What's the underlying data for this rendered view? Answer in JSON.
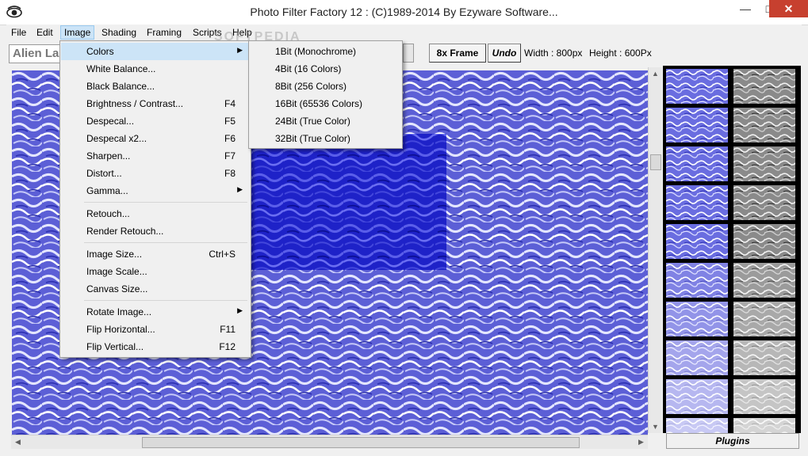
{
  "window": {
    "title": "Photo Filter Factory 12 : (C)1989-2014 By Ezyware Software..."
  },
  "menubar": [
    {
      "label": "File"
    },
    {
      "label": "Edit"
    },
    {
      "label": "Image"
    },
    {
      "label": "Shading"
    },
    {
      "label": "Framing"
    },
    {
      "label": "Scripts"
    },
    {
      "label": "Help"
    }
  ],
  "toolbar": {
    "filter_name": "Alien Landscape",
    "frame_label": "8x Frame",
    "undo_label": "Undo",
    "width_label": "Width : 800px",
    "height_label": "Height : 600Px"
  },
  "image_menu": [
    {
      "label": "Colors",
      "submenu": true
    },
    {
      "label": "White Balance..."
    },
    {
      "label": "Black Balance..."
    },
    {
      "label": "Brightness / Contrast...",
      "shortcut": "F4"
    },
    {
      "label": "Despecal...",
      "shortcut": "F5"
    },
    {
      "label": "Despecal x2...",
      "shortcut": "F6"
    },
    {
      "label": "Sharpen...",
      "shortcut": "F7"
    },
    {
      "label": "Distort...",
      "shortcut": "F8"
    },
    {
      "label": "Gamma...",
      "submenu": true
    },
    {
      "label": "Retouch..."
    },
    {
      "label": "Render Retouch..."
    },
    {
      "label": "Image Size...",
      "shortcut": "Ctrl+S"
    },
    {
      "label": "Image Scale..."
    },
    {
      "label": "Canvas Size..."
    },
    {
      "label": "Rotate Image...",
      "submenu": true
    },
    {
      "label": "Flip Horizontal...",
      "shortcut": "F11"
    },
    {
      "label": "Flip Vertical...",
      "shortcut": "F12"
    }
  ],
  "colors_menu": [
    {
      "label": "1Bit (Monochrome)"
    },
    {
      "label": "4Bit (16 Colors)"
    },
    {
      "label": "8Bit (256 Colors)"
    },
    {
      "label": "16Bit (65536 Colors)"
    },
    {
      "label": "24Bit (True Color)"
    },
    {
      "label": "32Bit (True Color)"
    }
  ],
  "plugins_label": "Plugins",
  "watermark": "SOFTPEDIA",
  "colors": {
    "canvas_blue": "#5c5fd6",
    "selection_blue": "#1e22c8",
    "menu_highlight": "#cce4f7",
    "close_red": "#c7402f"
  }
}
